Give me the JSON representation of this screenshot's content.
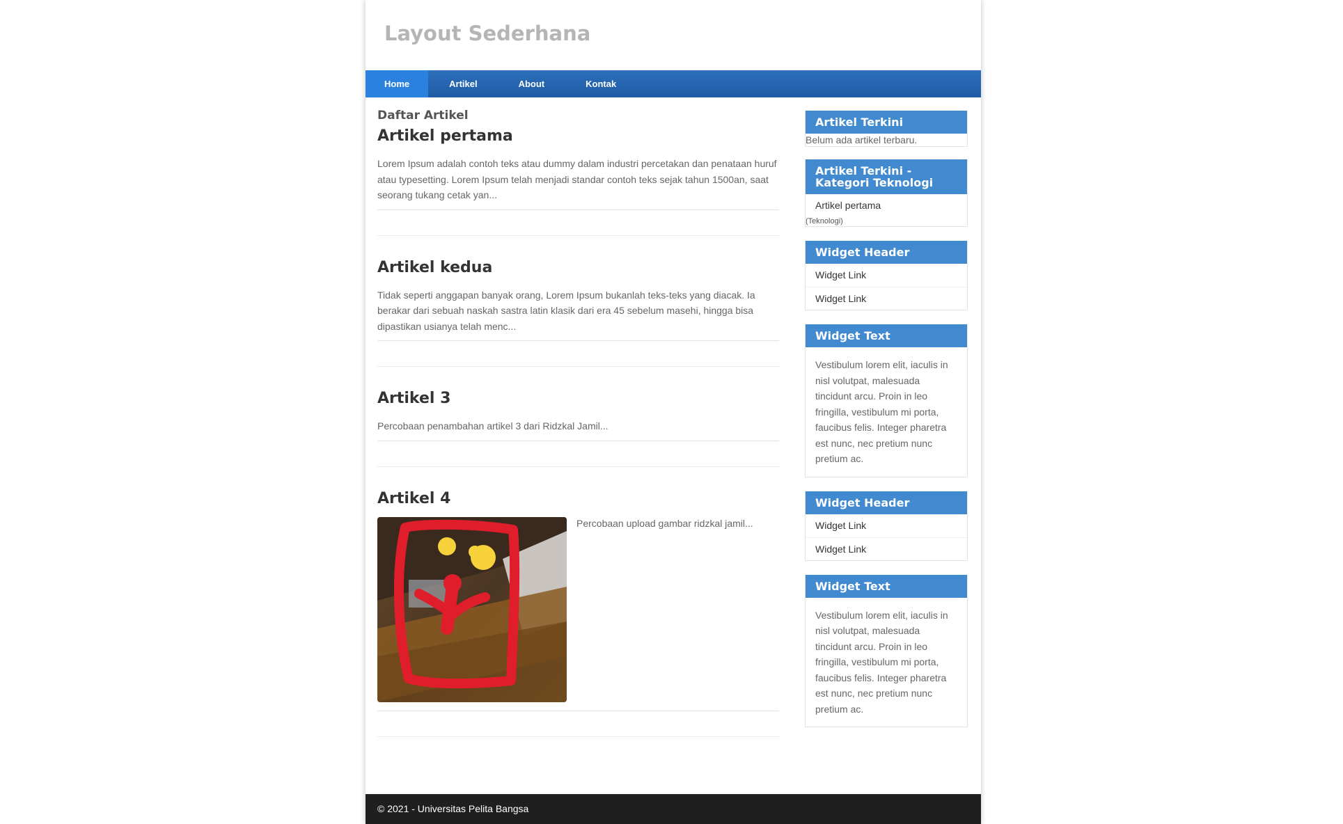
{
  "site": {
    "title": "Layout Sederhana"
  },
  "nav": {
    "items": [
      {
        "label": "Home"
      },
      {
        "label": "Artikel"
      },
      {
        "label": "About"
      },
      {
        "label": "Kontak"
      }
    ]
  },
  "main": {
    "heading": "Daftar Artikel",
    "articles": [
      {
        "title": "Artikel pertama",
        "excerpt": "Lorem Ipsum adalah contoh teks atau dummy dalam industri percetakan dan penataan huruf atau typesetting. Lorem Ipsum telah menjadi standar contoh teks sejak tahun 1500an, saat seorang tukang cetak yan..."
      },
      {
        "title": "Artikel kedua",
        "excerpt": "Tidak seperti anggapan banyak orang, Lorem Ipsum bukanlah teks-teks yang diacak. Ia berakar dari sebuah naskah sastra latin klasik dari era 45 sebelum masehi, hingga bisa dipastikan usianya telah menc..."
      },
      {
        "title": "Artikel 3",
        "excerpt": "Percobaan penambahan artikel 3 dari Ridzkal Jamil..."
      },
      {
        "title": "Artikel 4",
        "excerpt": "Percobaan upload gambar ridzkal jamil..."
      }
    ]
  },
  "sidebar": {
    "recent": {
      "title": "Artikel Terkini",
      "empty": "Belum ada artikel terbaru."
    },
    "tech": {
      "title": "Artikel Terkini - Kategori Teknologi",
      "item": "Artikel pertama",
      "category": "(Teknologi)"
    },
    "widget1": {
      "title": "Widget Header",
      "links": [
        "Widget Link",
        "Widget Link"
      ]
    },
    "text1": {
      "title": "Widget Text",
      "body": "Vestibulum lorem elit, iaculis in nisl volutpat, malesuada tincidunt arcu. Proin in leo fringilla, vestibulum mi porta, faucibus felis. Integer pharetra est nunc, nec pretium nunc pretium ac."
    },
    "widget2": {
      "title": "Widget Header",
      "links": [
        "Widget Link",
        "Widget Link"
      ]
    },
    "text2": {
      "title": "Widget Text",
      "body": "Vestibulum lorem elit, iaculis in nisl volutpat, malesuada tincidunt arcu. Proin in leo fringilla, vestibulum mi porta, faucibus felis. Integer pharetra est nunc, nec pretium nunc pretium ac."
    }
  },
  "footer": {
    "text": "© 2021 - Universitas Pelita Bangsa"
  },
  "colors": {
    "nav": "#1f5ca6",
    "nav_active": "#2b82de",
    "widget_header": "#418ad0",
    "footer": "#1f1f1f"
  }
}
